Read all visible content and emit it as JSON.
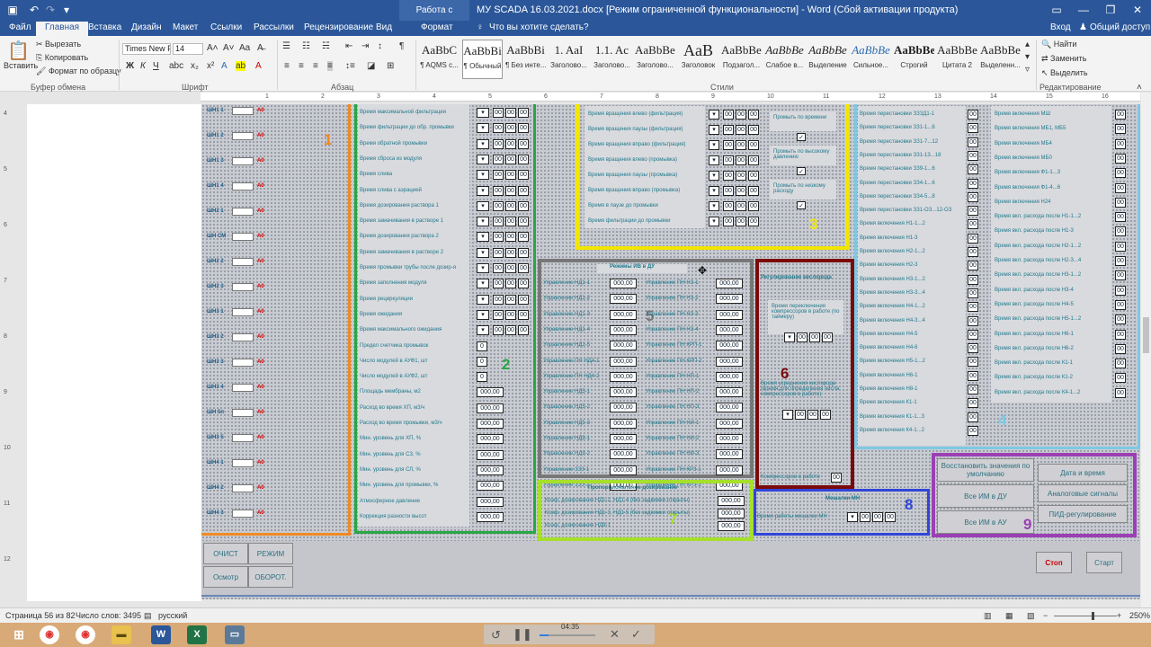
{
  "titlebar": {
    "context_group": "Работа с рисунками",
    "doc_title": "МУ SCADA 16.03.2021.docx [Режим ограниченной функциональности] - Word (Сбой активации продукта)"
  },
  "tabs": [
    "Файл",
    "Главная",
    "Вставка",
    "Дизайн",
    "Макет",
    "Ссылки",
    "Рассылки",
    "Рецензирование",
    "Вид",
    "Формат"
  ],
  "tell_me": "Что вы хотите сделать?",
  "account": {
    "signin": "Вход",
    "share": "Общий доступ"
  },
  "clipboard": {
    "paste": "Вставить",
    "cut": "Вырезать",
    "copy": "Копировать",
    "format_painter": "Формат по образцу",
    "group": "Буфер обмена"
  },
  "font": {
    "name": "Times New F",
    "size": "14",
    "group": "Шрифт"
  },
  "paragraph": {
    "group": "Абзац"
  },
  "styles": {
    "group": "Стили",
    "items": [
      {
        "preview": "AaBbC",
        "name": "¶ AQMS с..."
      },
      {
        "preview": "AaBbBi",
        "name": "¶ Обычный"
      },
      {
        "preview": "AaBbBi",
        "name": "¶ Без инте..."
      },
      {
        "preview": "1. AaI",
        "name": "Заголово..."
      },
      {
        "preview": "1.1. Ac",
        "name": "Заголово..."
      },
      {
        "preview": "AaBbBeF",
        "name": "Заголово..."
      },
      {
        "preview": "AaB",
        "name": "Заголовок"
      },
      {
        "preview": "AaBbBeF",
        "name": "Подзагол..."
      },
      {
        "preview": "AaBbBe",
        "name": "Слабое в..."
      },
      {
        "preview": "AaBbBe",
        "name": "Выделение"
      },
      {
        "preview": "AaBbBe",
        "name": "Сильное..."
      },
      {
        "preview": "AaBbBe",
        "name": "Строгий"
      },
      {
        "preview": "AaBbBe",
        "name": "Цитата 2"
      },
      {
        "preview": "AaBbBe",
        "name": "Выделенн..."
      }
    ]
  },
  "editing": {
    "find": "Найти",
    "replace": "Заменить",
    "select": "Выделить",
    "group": "Редактирование"
  },
  "scada": {
    "p1": {
      "num": "1",
      "widgets": [
        "ШН1 1",
        "ШН1 2",
        "ШН1 3",
        "ШН1 4",
        "ШН2 1",
        "ШН СМ",
        "ШН2 2",
        "ШН2 3",
        "ШН3 1",
        "ШН3 2",
        "ШН3 3",
        "ШН3 4",
        "ШН 5п",
        "ШН3 5",
        "ШН4 1",
        "ШН4 2",
        "ШН4 3"
      ]
    },
    "p2": {
      "num": "2",
      "labels": [
        "Время максимальной фильтрации",
        "Время фильтрации до обр. промывки",
        "Время обратной промывки",
        "Время сброса из модуля",
        "Время слива",
        "Время слива с аэрацией",
        "Время дозирования раствора 1",
        "Время замачивания в растворе 1",
        "Время дозирования раствора 2",
        "Время замачивания в растворе 2",
        "Время промывки трубы после дозир-я",
        "Время заполнения модуля",
        "Время рециркуляции",
        "Время ожидания",
        "Время максимального ожидания",
        "Предел счетчика промывок",
        "Число модулей в АУФ1, шт",
        "Число модулей в АУФ2, шт",
        "Площадь мембраны, м2",
        "Расход во время ХП, м3/ч",
        "Расход во время промывки, м3/ч",
        "Мин. уровень для ХП, %",
        "Мин. уровень для СЗ, %",
        "Мин. уровень для СЛ, %",
        "Мин. уровень для промывки, %",
        "Атмосферное давление",
        "Коррекция разности высот"
      ],
      "dval": "000,00"
    },
    "p3": {
      "num": "3",
      "labels": [
        "Время вращения влево (фильтрация)",
        "Время вращения паузы (фильтрация)",
        "Время вращения вправо (фильтрация)",
        "Время вращения влево (промывка)",
        "Время вращения паузы (промывка)",
        "Время вращения вправо (промывка)",
        "Время в паузе до промывки",
        "Время фильтрации до промывки"
      ],
      "opts": [
        "Промыть по времени",
        "Промыть по высокому давлению",
        "Промыть по низкому расходу"
      ]
    },
    "p4": {
      "num": "4",
      "col1": [
        "Время перестановки ЗЗЗД1-1",
        "Время перестановки ЗЗ1-1...6",
        "Время перестановки ЗЗ1-7...12",
        "Время перестановки ЗЗ1-13...18",
        "Время перестановки ЗЗ9-1...6",
        "Время перестановки ЗЗ4-1...6",
        "Время перестановки ЗЗ4-5...8",
        "Время перестановки ЗЗ1-ОЗ...12-ОЗ",
        "Время включения Н1-1...2",
        "Время включения Н1-3",
        "Время включения Н2-1...2",
        "Время включения Н2-3",
        "Время включения Н3-1...2",
        "Время включения Н3-3...4",
        "Время включения Н4-1...2",
        "Время включения Н4-3...4",
        "Время включения Н4-5",
        "Время включения Н4-6",
        "Время включения Н5-1...2",
        "Время включения Н6-1",
        "Время включения Н8-1",
        "Время включения К1-1",
        "Время включения К1-1...3",
        "Время включения К4-1...2"
      ],
      "col2": [
        "Время включения МШ",
        "Время включения МБ1, МБ5",
        "Время включения МБ4",
        "Время включения МБ0",
        "Время включения Ф1-1...3",
        "Время включения Ф1-4...6",
        "Время включения Н24",
        "Время вкл. расхода после Н1-1...2",
        "Время вкл. расхода после Н1-3",
        "Время вкл. расхода после Н2-1...2",
        "Время вкл. расхода после Н2-3...4",
        "Время вкл. расхода после Н3-1...2",
        "Время вкл. расхода после Н3-4",
        "Время вкл. расхода после Н4-5",
        "Время вкл. расхода после Н5-1...2",
        "Время вкл. расхода после Н6-1",
        "Время вкл. расхода после Н6-2",
        "Время вкл. расхода после К1-1",
        "Время вкл. расхода после К1-2",
        "Время вкл. расхода после К4-1...2"
      ]
    },
    "p5": {
      "num": "5",
      "title": "Режимы ИВ в ДУ",
      "left": [
        "Управление НД1-1",
        "Управление НД1-2",
        "Управление НД1-3",
        "Управление НД1-4",
        "Управление НД1-5",
        "Управление ПН НД4-1",
        "Управление ПН НД4-2",
        "Управление НД5-1",
        "Управление НД5-2",
        "Управление НД5-3",
        "Управление НД9-1",
        "Управление НД9-2",
        "Управление ЗЗЗ-1",
        "Управление ЗЗЗ-2"
      ],
      "right": [
        "Управление ПН НЗ-1",
        "Управление ПН НЗ-2",
        "Управление ПН НЗ-3",
        "Управление ПН НЗ-4",
        "Управление ПН КРП-1",
        "Управление ПН КРП-2",
        "Управление ПН НП-1",
        "Управление ПН НП-2",
        "Управление ПН НП-3",
        "Управление ПН НИ-1",
        "Управление ПН НИ-2",
        "Управление ПН НИ-3",
        "Управление ПН КРЗ-1",
        "Управление ПН КРЗ-3"
      ],
      "val": "000,00"
    },
    "p6": {
      "num": "6",
      "title": "Регулирование кислорода",
      "l1": "Время переключения компрессоров в работе (по таймеру)",
      "l2": "Время усреднения кислорода (время для определения числа компрессоров в работе)",
      "l3": "Компрессоров в работе"
    },
    "p7": {
      "num": "7",
      "title": "Пропорциональное дозирование",
      "labels": [
        "Коэф. дозирования НД1-2, НД1-4 (без задвижки открыты)",
        "Коэф. дозирования НД1-3, НД1-5 (без задвижки открыты)",
        "Коэф. дозирования НД9-1"
      ],
      "val": "000,00"
    },
    "p8": {
      "num": "8",
      "title": "Мешалки МН",
      "label": "Время работы мешалки МН"
    },
    "p9": {
      "num": "9",
      "left": [
        "Восстановить значения по умолчанию",
        "Все ИМ в ДУ",
        "Все ИМ в АУ"
      ],
      "right": [
        "Дата и время",
        "Аналоговые сигналы",
        "ПИД-регулирование"
      ]
    },
    "bottom": {
      "stop": "Стоп",
      "start": "Старт",
      "b1": "ОЧИСТ",
      "b2": "РЕЖИМ",
      "b3": "Осмотр",
      "b4": "ОБОРОТ."
    }
  },
  "statusbar": {
    "page": "Страница 56 из 82",
    "words": "Число слов: 3495",
    "lang": "русский",
    "zoom": "250%"
  },
  "player": {
    "time": "04:35"
  }
}
